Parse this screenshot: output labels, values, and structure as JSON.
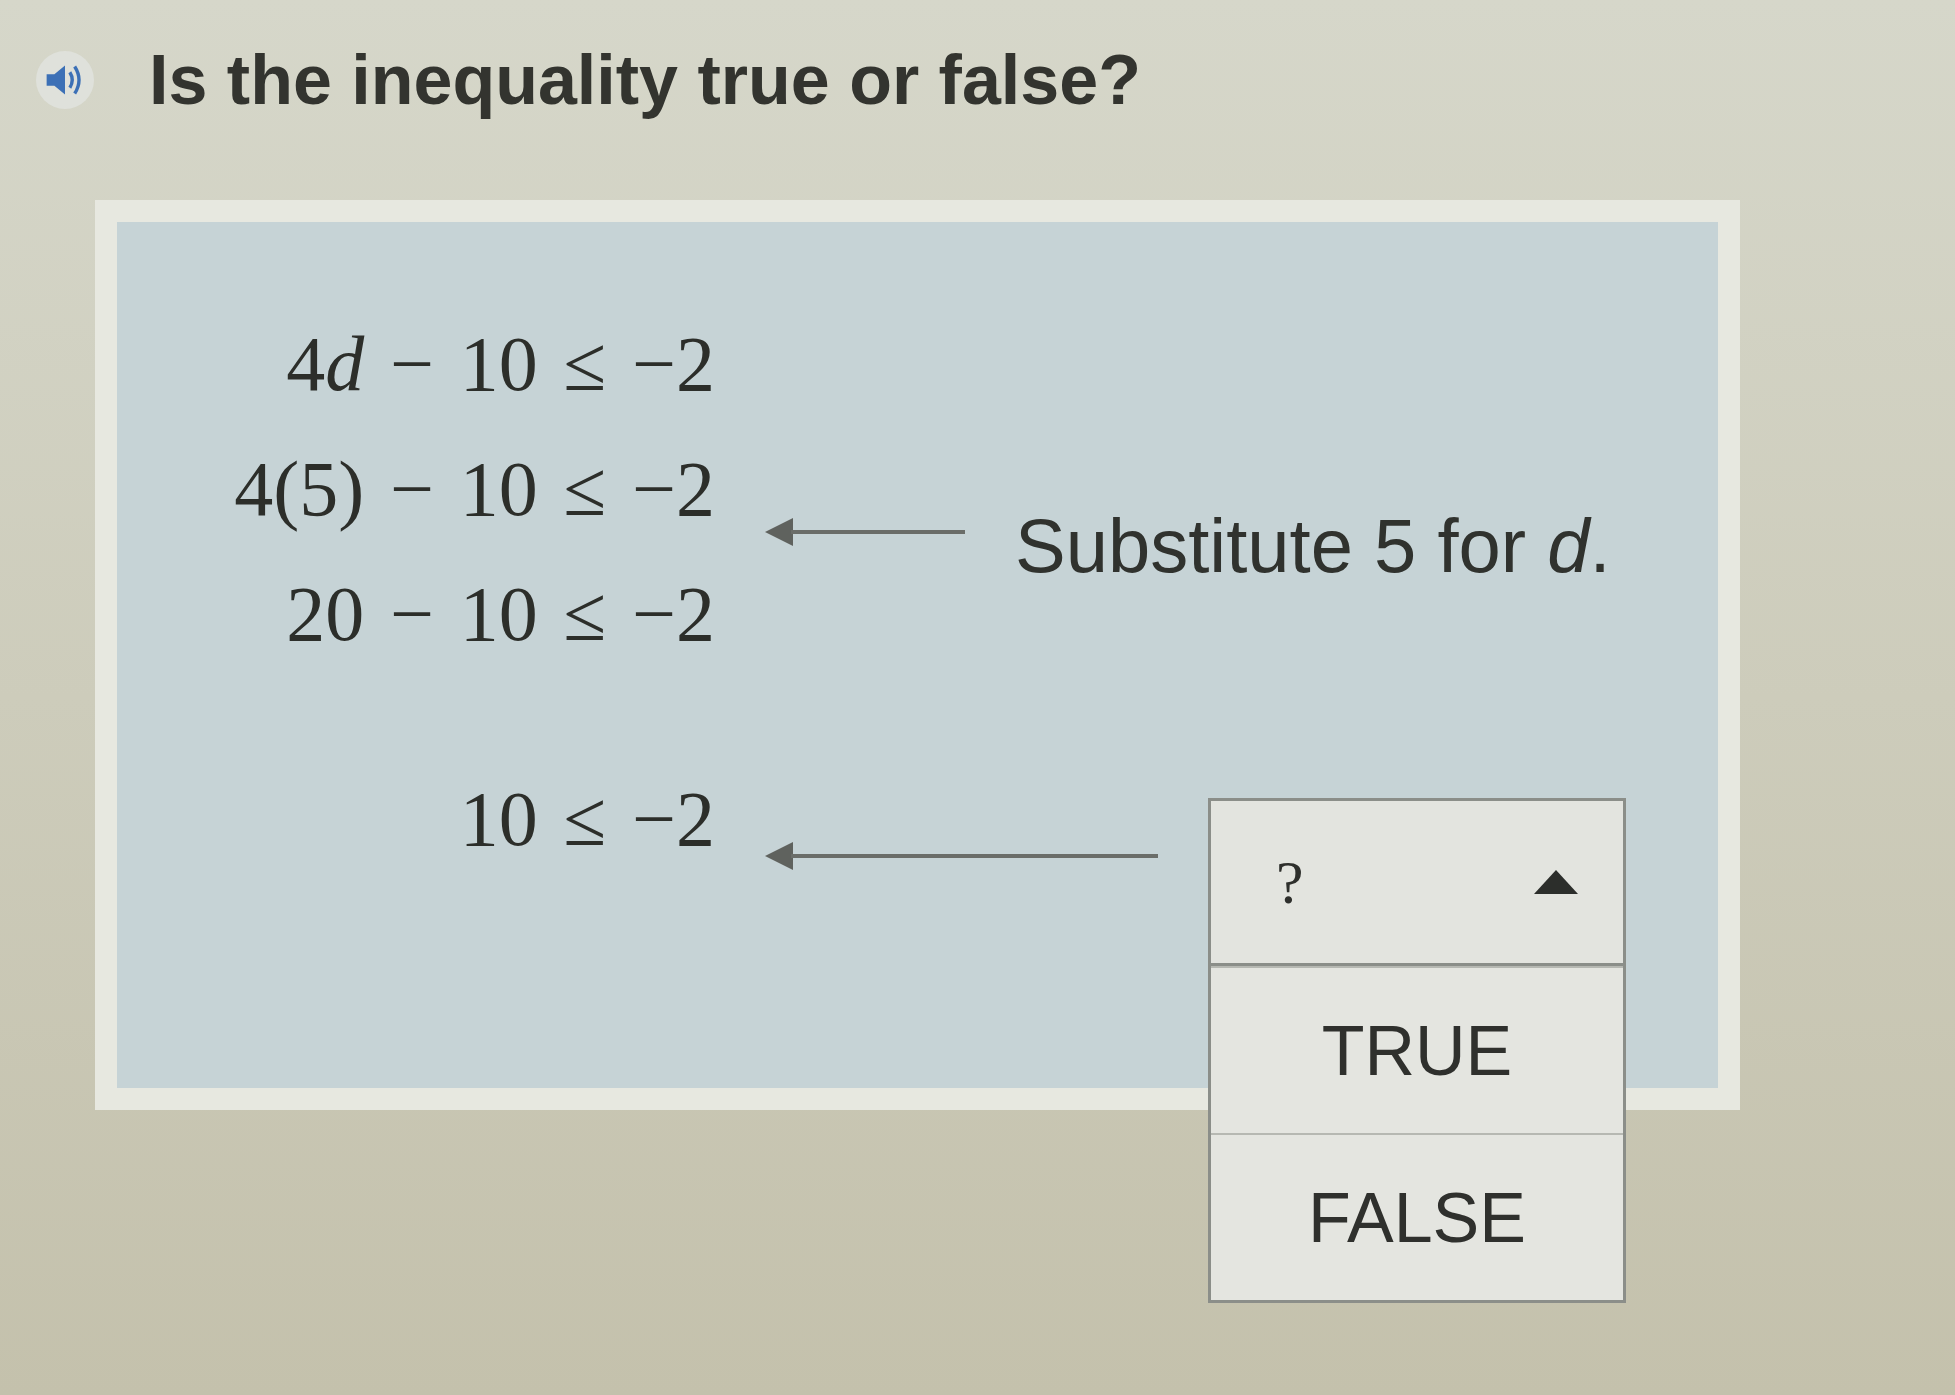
{
  "question": {
    "title": "Is the inequality true or false?"
  },
  "work": {
    "steps": [
      {
        "kind": "plain",
        "expression": [
          {
            "text": "4",
            "italic": false
          },
          {
            "text": "d",
            "italic": true
          },
          {
            "text": " − 10 ≤ −2",
            "italic": false
          }
        ]
      },
      {
        "kind": "note",
        "expression": [
          {
            "text": "4(5) − 10 ≤ −2",
            "italic": false
          }
        ],
        "note": "Substitute 5 for *d*."
      },
      {
        "kind": "plain",
        "expression": [
          {
            "text": "20 − 10 ≤ −2",
            "italic": false
          }
        ]
      },
      {
        "kind": "answer",
        "expression": [
          {
            "text": "10 ≤ −2",
            "italic": false
          }
        ],
        "dropdown": {
          "placeholder": "?",
          "expanded": true,
          "options": [
            {
              "label": "TRUE",
              "selected": false
            },
            {
              "label": "FALSE",
              "selected": false
            }
          ]
        }
      }
    ]
  }
}
